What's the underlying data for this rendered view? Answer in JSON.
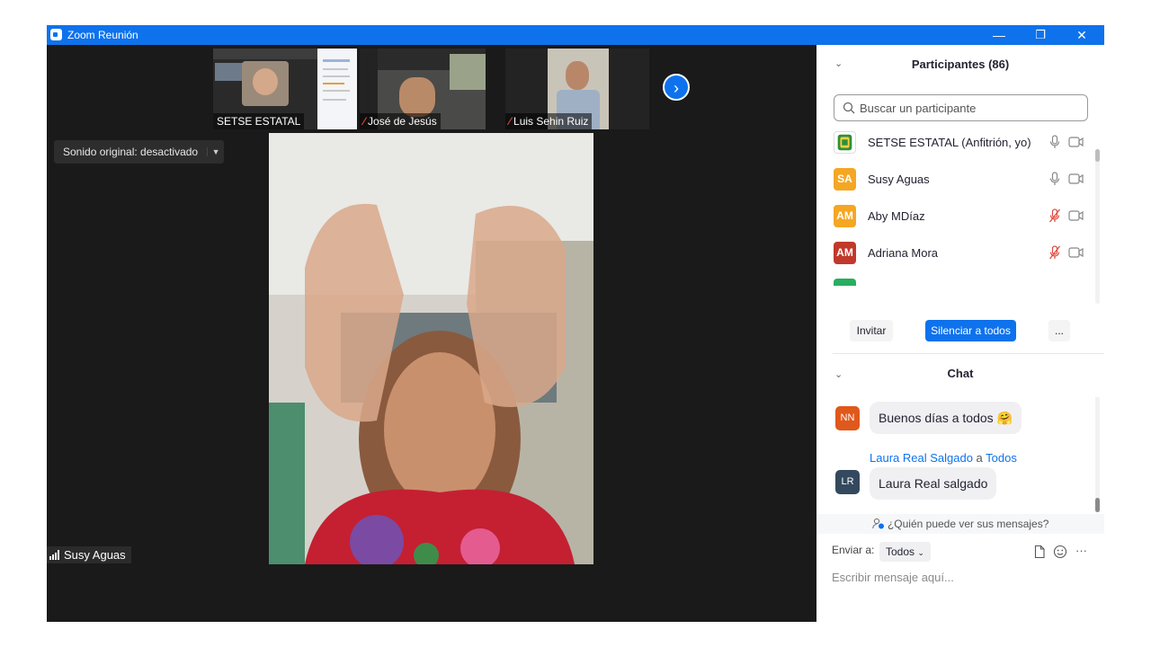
{
  "window": {
    "title": "Zoom Reunión",
    "minimize_glyph": "—",
    "restore_glyph": "❐",
    "close_glyph": "✕"
  },
  "thumbnails": [
    {
      "name": "SETSE ESTATAL",
      "muted": false
    },
    {
      "name": "José de Jesús",
      "muted": true
    },
    {
      "name": "Luis Sehin Ruiz",
      "muted": true
    }
  ],
  "next_button_glyph": "›",
  "sound": {
    "label": "Sonido original: desactivado",
    "dropdown_glyph": "▼"
  },
  "active_speaker": {
    "name": "Susy Aguas"
  },
  "participants": {
    "title": "Participantes (86)",
    "search_placeholder": "Buscar un participante",
    "list": [
      {
        "initials": "",
        "name": "SETSE ESTATAL (Anfitrión, yo)",
        "color": "#ffffff",
        "mic_muted": false
      },
      {
        "initials": "SA",
        "name": "Susy Aguas",
        "color": "#f5a623",
        "mic_muted": false
      },
      {
        "initials": "AM",
        "name": "Aby MDíaz",
        "color": "#f5a623",
        "mic_muted": true
      },
      {
        "initials": "AM",
        "name": "Adriana Mora",
        "color": "#c0392b",
        "mic_muted": true
      }
    ],
    "invite_label": "Invitar",
    "mute_all_label": "Silenciar a todos",
    "more_label": "..."
  },
  "chat": {
    "title": "Chat",
    "messages": [
      {
        "initials": "NN",
        "color": "#e0581b",
        "text": "Buenos días a todos",
        "emoji": "🤗"
      },
      {
        "initials": "LR",
        "color": "#34495e",
        "sender": "Laura Real Salgado",
        "connector": "a",
        "recipient": "Todos",
        "text": "Laura Real salgado"
      }
    ],
    "who_can_see": "¿Quién puede ver sus mensajes?",
    "send_to_label": "Enviar a:",
    "send_to_value": "Todos",
    "compose_placeholder": "Escribir mensaje aquí...",
    "more_label": "···"
  },
  "colors": {
    "accent": "#0e72ed",
    "muted_red": "#e0483e"
  }
}
